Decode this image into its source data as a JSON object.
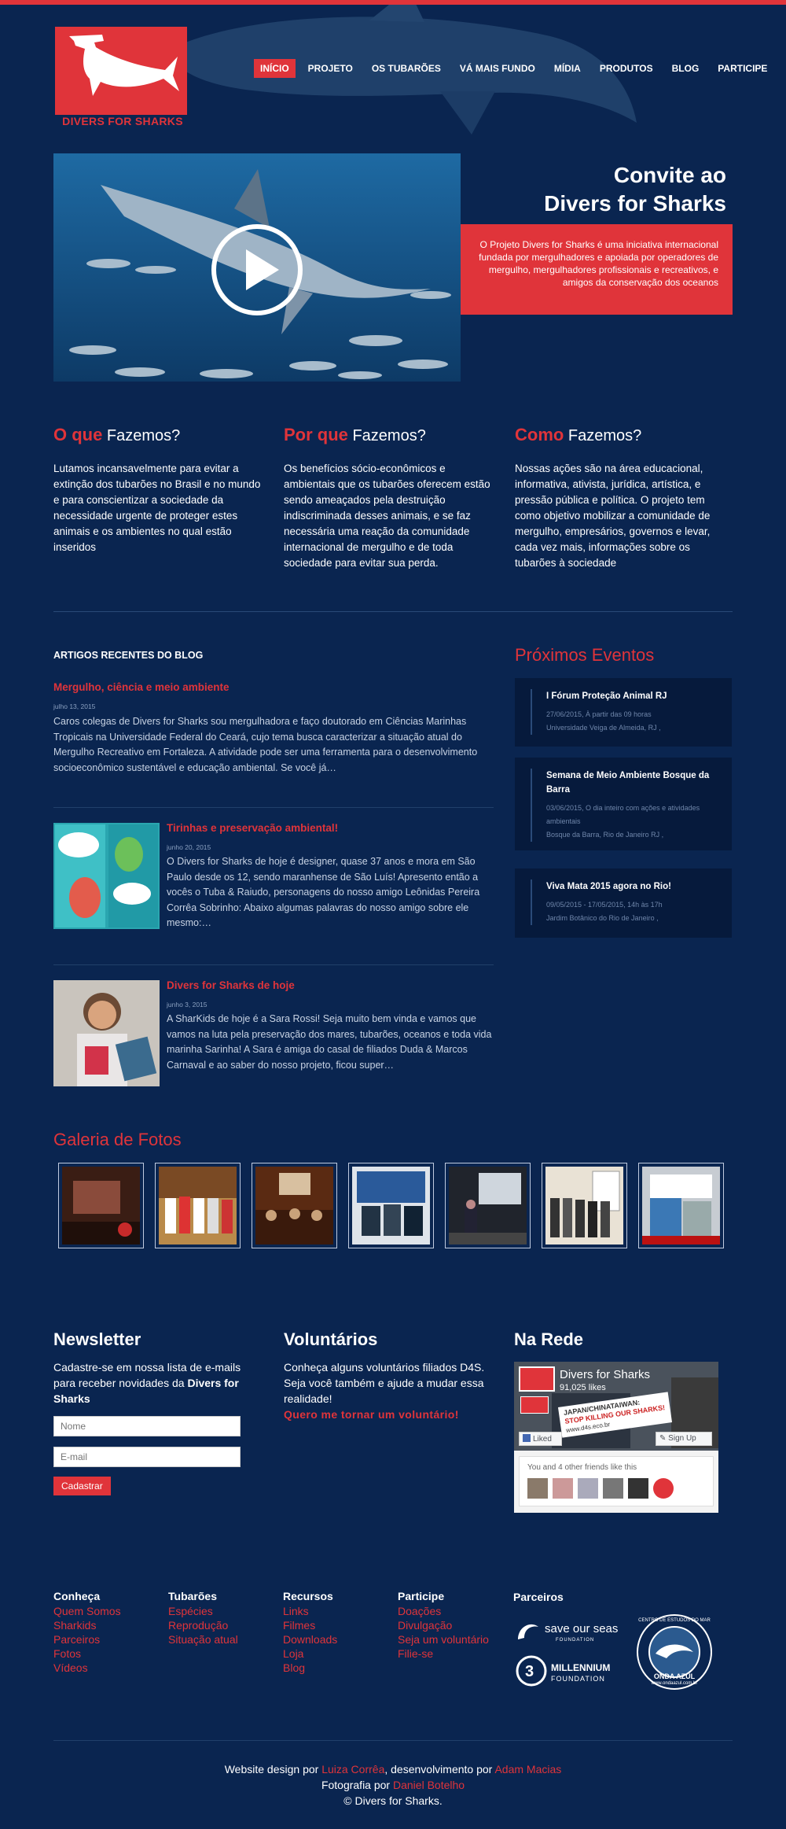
{
  "brand": {
    "name": "DIVERS FOR SHARKS",
    "accent": "#e0343a",
    "bg": "#0a2550"
  },
  "nav": [
    {
      "label": "INÍCIO",
      "active": true
    },
    {
      "label": "PROJETO"
    },
    {
      "label": "OS TUBARÕES"
    },
    {
      "label": "VÁ MAIS FUNDO"
    },
    {
      "label": "MÍDIA"
    },
    {
      "label": "PRODUTOS"
    },
    {
      "label": "BLOG"
    },
    {
      "label": "PARTICIPE"
    }
  ],
  "hero": {
    "title_line1": "Convite ao",
    "title_line2": "Divers for Sharks",
    "text": "O Projeto Divers for Sharks é uma iniciativa internacional fundada por mergulhadores e apoiada por operadores de mergulho, mergulhadores profissionais e recreativos, e amigos da conservação dos oceanos"
  },
  "columns": [
    {
      "red": "O que",
      "rest": "Fazemos?",
      "text": "Lutamos incansavelmente para evitar a extinção dos tubarões no Brasil e no mundo e para conscientizar a sociedade da necessidade urgente de proteger estes animais e os ambientes no qual estão inseridos"
    },
    {
      "red": "Por que",
      "rest": "Fazemos?",
      "text": "Os benefícios sócio-econômicos e ambientais que os tubarões oferecem estão sendo ameaçados pela destruição indiscriminada desses animais, e se faz necessária uma reação da comunidade internacional de mergulho e de toda sociedade para evitar sua perda."
    },
    {
      "red": "Como",
      "rest": "Fazemos?",
      "text": "Nossas ações são na área educacional, informativa, ativista, jurídica, artística, e pressão pública e política. O projeto tem como objetivo mobilizar a comunidade de mergulho, empresários, governos e levar, cada vez mais, informações sobre os tubarões à sociedade"
    }
  ],
  "blog": {
    "heading": "ARTIGOS RECENTES DO BLOG",
    "posts": [
      {
        "title": "Mergulho, ciência e meio ambiente",
        "date": "julho 13, 2015",
        "text": "Caros colegas de Divers for Sharks sou mergulhadora e faço doutorado em Ciências Marinhas Tropicais na Universidade Federal do Ceará, cujo tema busca caracterizar  a situação atual do Mergulho Recreativo em Fortaleza. A atividade pode ser uma ferramenta para o desenvolvimento socioeconômico sustentável e educação ambiental. Se você já…"
      },
      {
        "title": "Tirinhas e preservação ambiental!",
        "date": "junho 20, 2015",
        "text": "O Divers for Sharks de hoje é designer, quase 37 anos e mora em São Paulo desde os 12, sendo maranhense de São Luís! Apresento então a vocês o Tuba & Raiudo, personagens do nosso amigo Leônidas Pereira Corrêa Sobrinho: Abaixo algumas palavras do nosso amigo sobre ele mesmo:…"
      },
      {
        "title": "Divers for Sharks de hoje",
        "date": "junho 3, 2015",
        "text": "A SharKids de hoje é a Sara Rossi! Seja muito bem vinda e vamos que vamos na luta pela preservação dos mares, tubarões, oceanos e toda vida marinha Sarinha! A Sara é amiga do casal de filiados Duda & Marcos Carnaval e ao saber do nosso projeto, ficou super…"
      }
    ]
  },
  "events": {
    "heading": "Próximos Eventos",
    "items": [
      {
        "title": "I Fórum Proteção Animal RJ",
        "when": "27/06/2015, À partir das 09 horas",
        "where": "Universidade Veiga de Almeida, RJ ,"
      },
      {
        "title": "Semana de Meio Ambiente Bosque da Barra",
        "when": "03/06/2015, O dia inteiro com ações e atividades ambientais",
        "where": "Bosque da Barra, Rio de Janeiro RJ ,"
      },
      {
        "title": "Viva Mata 2015 agora no Rio!",
        "when": "09/05/2015 - 17/05/2015, 14h às 17h",
        "where": "Jardim Botânico do Rio de Janeiro ,"
      }
    ]
  },
  "gallery": {
    "heading": "Galeria de Fotos"
  },
  "newsletter": {
    "heading": "Newsletter",
    "text": "Cadastre-se em nossa lista de e-mails para receber novidades da ",
    "text_bold": "Divers for Sharks",
    "name_placeholder": "Nome",
    "email_placeholder": "E-mail",
    "button": "Cadastrar"
  },
  "volunteers": {
    "heading": "Voluntários",
    "text": "Conheça alguns voluntários filiados D4S. Seja você também e ajude a mudar essa realidade!",
    "link": "Quero me tornar um voluntário!"
  },
  "social": {
    "heading": "Na Rede",
    "page_name": "Divers for Sharks",
    "likes": "91,025 likes",
    "liked": "Liked",
    "signup": "Sign Up",
    "friends": "You and 4 other friends like this",
    "banner_line1": "JAPAN/CHINATAIWAN:",
    "banner_line2": "STOP KILLING OUR SHARKS!",
    "banner_url": "www.d4s.eco.br"
  },
  "footer_links": [
    {
      "heading": "Conheça",
      "links": [
        "Quem Somos",
        "Sharkids",
        "Parceiros",
        "Fotos",
        "Vídeos"
      ]
    },
    {
      "heading": "Tubarões",
      "links": [
        "Espécies",
        "Reprodução",
        "Situação atual"
      ]
    },
    {
      "heading": "Recursos",
      "links": [
        "Links",
        "Filmes",
        "Downloads",
        "Loja",
        "Blog"
      ]
    },
    {
      "heading": "Participe",
      "links": [
        "Doações",
        "Divulgação",
        "Seja um voluntário",
        "Filie-se"
      ]
    }
  ],
  "partners": {
    "heading": "Parceiros",
    "p1": "save our seas",
    "p1_sub": "FOUNDATION",
    "p2": "MILLENNIUM",
    "p2_sub": "FOUNDATION",
    "p3_top": "CENTRO DE ESTUDOS DO MAR",
    "p3": "ONDA AZUL",
    "p3_url": "www.ondaazul.com.br"
  },
  "credits": {
    "l1a": "Website design por ",
    "l1b": "Luiza Corrêa",
    "l1c": ", desenvolvimento por ",
    "l1d": "Adam Macias",
    "l2a": "Fotografia por ",
    "l2b": "Daniel Botelho",
    "l3": "© Divers for Sharks."
  }
}
